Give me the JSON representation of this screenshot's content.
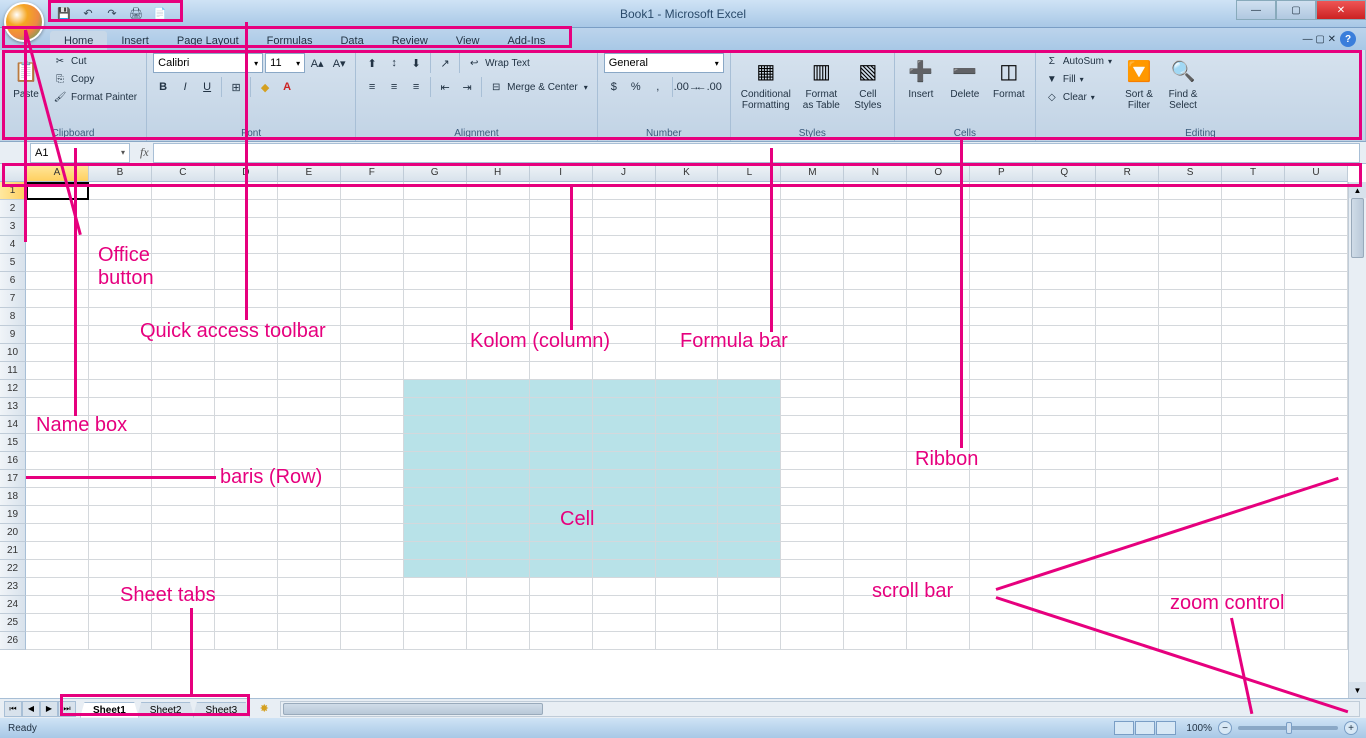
{
  "title": "Book1 - Microsoft Excel",
  "tabs": [
    "Home",
    "Insert",
    "Page Layout",
    "Formulas",
    "Data",
    "Review",
    "View",
    "Add-Ins"
  ],
  "active_tab": "Home",
  "clipboard": {
    "label": "Clipboard",
    "paste": "Paste",
    "cut": "Cut",
    "copy": "Copy",
    "fmtpainter": "Format Painter"
  },
  "font": {
    "label": "Font",
    "name": "Calibri",
    "size": "11"
  },
  "alignment": {
    "label": "Alignment",
    "wrap": "Wrap Text",
    "merge": "Merge & Center"
  },
  "number": {
    "label": "Number",
    "format": "General"
  },
  "styles": {
    "label": "Styles",
    "cond": "Conditional\nFormatting",
    "fmt": "Format\nas Table",
    "cell": "Cell\nStyles"
  },
  "cells_group": {
    "label": "Cells",
    "insert": "Insert",
    "delete": "Delete",
    "format": "Format"
  },
  "editing": {
    "label": "Editing",
    "autosum": "AutoSum",
    "fill": "Fill",
    "clear": "Clear",
    "sort": "Sort &\nFilter",
    "find": "Find &\nSelect"
  },
  "namebox": "A1",
  "columns": [
    "A",
    "B",
    "C",
    "D",
    "E",
    "F",
    "G",
    "H",
    "I",
    "J",
    "K",
    "L",
    "M",
    "N",
    "O",
    "P",
    "Q",
    "R",
    "S",
    "T",
    "U"
  ],
  "row_count": 26,
  "highlight": {
    "row_start": 12,
    "row_end": 22,
    "col_start": 7,
    "col_end": 12
  },
  "sheets": [
    "Sheet1",
    "Sheet2",
    "Sheet3"
  ],
  "active_sheet": "Sheet1",
  "status": "Ready",
  "zoom": "100%",
  "annotations": {
    "office": "Office\nbutton",
    "qat": "Quick access toolbar",
    "kolom": "Kolom (column)",
    "fbar": "Formula bar",
    "namebox": "Name box",
    "baris": "baris (Row)",
    "cell": "Cell",
    "ribbon": "Ribbon",
    "scroll": "scroll bar",
    "sheet": "Sheet tabs",
    "zoom": "zoom control"
  }
}
